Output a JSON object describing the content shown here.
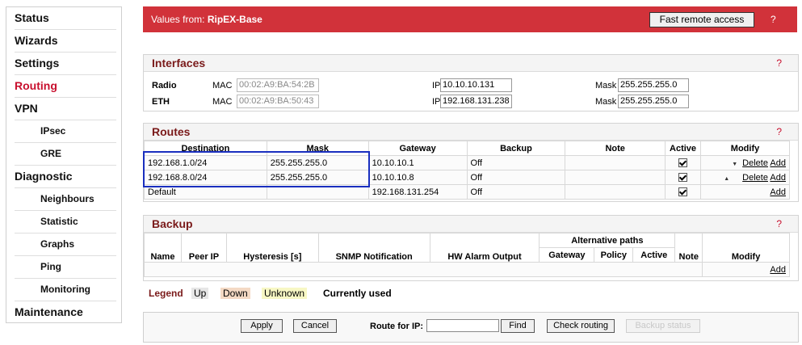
{
  "sidebar": {
    "items": [
      {
        "label": "Status"
      },
      {
        "label": "Wizards"
      },
      {
        "label": "Settings"
      },
      {
        "label": "Routing",
        "active": true
      },
      {
        "label": "VPN"
      },
      {
        "label": "IPsec",
        "sub": true
      },
      {
        "label": "GRE",
        "sub": true
      },
      {
        "label": "Diagnostic"
      },
      {
        "label": "Neighbours",
        "sub": true
      },
      {
        "label": "Statistic",
        "sub": true
      },
      {
        "label": "Graphs",
        "sub": true
      },
      {
        "label": "Ping",
        "sub": true
      },
      {
        "label": "Monitoring",
        "sub": true
      },
      {
        "label": "Maintenance"
      }
    ]
  },
  "header": {
    "values_from_label": "Values from: ",
    "device_name": "RipEX-Base",
    "fast_remote_access": "Fast remote access",
    "help": "?"
  },
  "interfaces": {
    "title": "Interfaces",
    "help": "?",
    "radio": {
      "label": "Radio",
      "mac_label": "MAC",
      "mac": "00:02:A9:BA:54:2B",
      "ip_label": "IP",
      "ip": "10.10.10.131",
      "mask_label": "Mask",
      "mask": "255.255.255.0"
    },
    "eth": {
      "label": "ETH",
      "mac_label": "MAC",
      "mac": "00:02:A9:BA:50:43",
      "ip_label": "IP",
      "ip": "192.168.131.238",
      "mask_label": "Mask",
      "mask": "255.255.255.0"
    }
  },
  "routes": {
    "title": "Routes",
    "help": "?",
    "columns": [
      "Destination",
      "Mask",
      "Gateway",
      "Backup",
      "Note",
      "Active",
      "Modify"
    ],
    "rows": [
      {
        "destination": "192.168.1.0/24",
        "mask": "255.255.255.0",
        "gateway": "10.10.10.1",
        "backup": "Off",
        "note": "",
        "active": true,
        "delete": "Delete",
        "add": "Add"
      },
      {
        "destination": "192.168.8.0/24",
        "mask": "255.255.255.0",
        "gateway": "10.10.10.8",
        "backup": "Off",
        "note": "",
        "active": true,
        "delete": "Delete",
        "add": "Add"
      },
      {
        "destination": "Default",
        "mask": "",
        "gateway": "192.168.131.254",
        "backup": "Off",
        "note": "",
        "active": true,
        "delete": "",
        "add": "Add"
      }
    ]
  },
  "backup": {
    "title": "Backup",
    "help": "?",
    "group_header": "Alternative paths",
    "columns": [
      "Name",
      "Peer IP",
      "Hysteresis [s]",
      "SNMP Notification",
      "HW Alarm Output",
      "Gateway",
      "Policy",
      "Active",
      "Note",
      "Modify"
    ],
    "add": "Add"
  },
  "legend": {
    "title": "Legend",
    "up": "Up",
    "down": "Down",
    "unknown": "Unknown",
    "current": "Currently used"
  },
  "bottom": {
    "apply": "Apply",
    "cancel": "Cancel",
    "route_for_ip_label": "Route for IP:",
    "route_for_ip_value": "",
    "find": "Find",
    "check_routing": "Check routing",
    "backup_status": "Backup status"
  },
  "colors": {
    "accent": "#d1323a",
    "title_text": "#7a1a1a",
    "highlight": "#1a2fbf"
  }
}
